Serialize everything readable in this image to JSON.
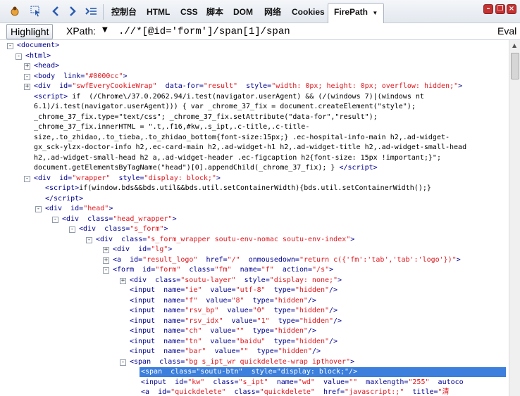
{
  "toolbar": {
    "tabs": [
      "控制台",
      "HTML",
      "CSS",
      "脚本",
      "DOM",
      "网络",
      "Cookies"
    ],
    "active_tab": "FirePath",
    "dropdown_glyph": "▼",
    "icons": [
      "firebug-bug-icon",
      "inspect-element-icon",
      "back-arrow-icon",
      "forward-arrow-icon",
      "command-line-icon"
    ],
    "window_buttons": [
      "minimize-icon",
      "restore-icon",
      "close-icon"
    ]
  },
  "xpath": {
    "highlight_label": "Highlight",
    "label": "XPath:",
    "drop_glyph": "▼",
    "value": ".//*[@id='form']/span[1]/span",
    "eval_label": "Eval"
  },
  "tree": [
    {
      "d": 0,
      "tg": "-",
      "h": "<span class=\"t\">&lt;document&gt;</span>"
    },
    {
      "d": 1,
      "tg": "-",
      "h": "<span class=\"t\">&lt;html&gt;</span>"
    },
    {
      "d": 2,
      "tg": "+",
      "h": "<span class=\"t\">&lt;head&gt;</span>"
    },
    {
      "d": 2,
      "tg": "-",
      "h": "<span class=\"t\">&lt;body</span>  <span class=\"a\">link=</span><span class=\"v\">\"#0000cc\"</span><span class=\"t\">&gt;</span>"
    },
    {
      "d": 3,
      "tg": "+",
      "h": "<span class=\"t\">&lt;div</span>  <span class=\"a\">id=</span><span class=\"v\">\"swfEveryCookieWrap\"</span>  <span class=\"a\">data-for=</span><span class=\"v\">\"result\"</span>  <span class=\"a\">style=</span><span class=\"v\">\"width: 0px; height: 0px; overflow: hidden;\"</span><span class=\"t\">&gt;</span>"
    },
    {
      "d": 3,
      "tg": "",
      "h": "<span class=\"t\">&lt;script&gt;</span><span class=\"tx\"> if  (/Chrome\\/37.0.2062.94/i.test(navigator.userAgent) &amp;&amp; (/(windows 7)|(windows nt</span>"
    },
    {
      "d": 3,
      "tg": "",
      "h": "<span class=\"tx\">6.1)/i.test(navigator.userAgent))) { var _chrome_37_fix = document.createElement(\"style\");</span>"
    },
    {
      "d": 3,
      "tg": "",
      "h": "<span class=\"tx\">_chrome_37_fix.type=\"text/css\"; _chrome_37_fix.setAttribute(\"data-for\",\"result\");</span>"
    },
    {
      "d": 3,
      "tg": "",
      "h": "<span class=\"tx\">_chrome_37_fix.innerHTML = \".t,.f16,#kw,.s_ipt,.c-title,.c-title-</span>"
    },
    {
      "d": 3,
      "tg": "",
      "h": "<span class=\"tx\">size,.to_zhidao,.to_tieba,.to_zhidao_bottom{font-size:15px;} .ec-hospital-info-main h2,.ad-widget-</span>"
    },
    {
      "d": 3,
      "tg": "",
      "h": "<span class=\"tx\">gx_sck-ylzx-doctor-info h2,.ec-card-main h2,.ad-widget-h1 h2,.ad-widget-title h2,.ad-widget-small-head</span>"
    },
    {
      "d": 3,
      "tg": "",
      "h": "<span class=\"tx\">h2,.ad-widget-small-head h2 a,.ad-widget-header .ec-figcaption h2{font-size: 15px !important;}\";</span>"
    },
    {
      "d": 3,
      "tg": "",
      "h": "<span class=\"tx\">document.getElementsByTagName(\"head\")[0].appendChild(_chrome_37_fix); } </span><span class=\"t\">&lt;/script&gt;</span>"
    },
    {
      "d": 3,
      "tg": "-",
      "h": "<span class=\"t\">&lt;div</span>  <span class=\"a\">id=</span><span class=\"v\">\"wrapper\"</span>  <span class=\"a\">style=</span><span class=\"v\">\"display: block;\"</span><span class=\"t\">&gt;</span>"
    },
    {
      "d": 4,
      "tg": "",
      "h": "<span class=\"t\">&lt;script&gt;</span><span class=\"tx\">if(window.bds&amp;&amp;bds.util&amp;&amp;bds.util.setContainerWidth){bds.util.setContainerWidth();}</span>"
    },
    {
      "d": 4,
      "tg": "",
      "h": "<span class=\"t\">&lt;/script&gt;</span>"
    },
    {
      "d": 4,
      "tg": "-",
      "h": "<span class=\"t\">&lt;div</span>  <span class=\"a\">id=</span><span class=\"v\">\"head\"</span><span class=\"t\">&gt;</span>"
    },
    {
      "d": 5,
      "tg": "-",
      "h": "<span class=\"t\">&lt;div</span>  <span class=\"a\">class=</span><span class=\"v\">\"head_wrapper\"</span><span class=\"t\">&gt;</span>"
    },
    {
      "d": 6,
      "tg": "-",
      "h": "<span class=\"t\">&lt;div</span>  <span class=\"a\">class=</span><span class=\"v\">\"s_form\"</span><span class=\"t\">&gt;</span>"
    },
    {
      "d": 7,
      "tg": "-",
      "h": "<span class=\"t\">&lt;div</span>  <span class=\"a\">class=</span><span class=\"v\">\"s_form_wrapper soutu-env-nomac soutu-env-index\"</span><span class=\"t\">&gt;</span>"
    },
    {
      "d": 8,
      "tg": "+",
      "h": "<span class=\"t\">&lt;div</span>  <span class=\"a\">id=</span><span class=\"v\">\"lg\"</span><span class=\"t\">&gt;</span>"
    },
    {
      "d": 8,
      "tg": "+",
      "h": "<span class=\"t\">&lt;a</span>  <span class=\"a\">id=</span><span class=\"v\">\"result_logo\"</span>  <span class=\"a\">href=</span><span class=\"v\">\"/\"</span>  <span class=\"a\">onmousedown=</span><span class=\"v\">\"return c({'fm':'tab','tab':'logo'})\"</span><span class=\"t\">&gt;</span>"
    },
    {
      "d": 8,
      "tg": "-",
      "h": "<span class=\"t\">&lt;form</span>  <span class=\"a\">id=</span><span class=\"v\">\"form\"</span>  <span class=\"a\">class=</span><span class=\"v\">\"fm\"</span>  <span class=\"a\">name=</span><span class=\"v\">\"f\"</span>  <span class=\"a\">action=</span><span class=\"v\">\"/s\"</span><span class=\"t\">&gt;</span>"
    },
    {
      "d": 9,
      "tg": "+",
      "h": "<span class=\"t\">&lt;div</span>  <span class=\"a\">class=</span><span class=\"v\">\"soutu-layer\"</span>  <span class=\"a\">style=</span><span class=\"v\">\"display: none;\"</span><span class=\"t\">&gt;</span>"
    },
    {
      "d": 9,
      "tg": "",
      "h": "<span class=\"t\">&lt;input</span>  <span class=\"a\">name=</span><span class=\"v\">\"ie\"</span>  <span class=\"a\">value=</span><span class=\"v\">\"utf-8\"</span>  <span class=\"a\">type=</span><span class=\"v\">\"hidden\"</span><span class=\"t\">/&gt;</span>"
    },
    {
      "d": 9,
      "tg": "",
      "h": "<span class=\"t\">&lt;input</span>  <span class=\"a\">name=</span><span class=\"v\">\"f\"</span>  <span class=\"a\">value=</span><span class=\"v\">\"8\"</span>  <span class=\"a\">type=</span><span class=\"v\">\"hidden\"</span><span class=\"t\">/&gt;</span>"
    },
    {
      "d": 9,
      "tg": "",
      "h": "<span class=\"t\">&lt;input</span>  <span class=\"a\">name=</span><span class=\"v\">\"rsv_bp\"</span>  <span class=\"a\">value=</span><span class=\"v\">\"0\"</span>  <span class=\"a\">type=</span><span class=\"v\">\"hidden\"</span><span class=\"t\">/&gt;</span>"
    },
    {
      "d": 9,
      "tg": "",
      "h": "<span class=\"t\">&lt;input</span>  <span class=\"a\">name=</span><span class=\"v\">\"rsv_idx\"</span>  <span class=\"a\">value=</span><span class=\"v\">\"1\"</span>  <span class=\"a\">type=</span><span class=\"v\">\"hidden\"</span><span class=\"t\">/&gt;</span>"
    },
    {
      "d": 9,
      "tg": "",
      "h": "<span class=\"t\">&lt;input</span>  <span class=\"a\">name=</span><span class=\"v\">\"ch\"</span>  <span class=\"a\">value=</span><span class=\"v\">\"\"</span>  <span class=\"a\">type=</span><span class=\"v\">\"hidden\"</span><span class=\"t\">/&gt;</span>"
    },
    {
      "d": 9,
      "tg": "",
      "h": "<span class=\"t\">&lt;input</span>  <span class=\"a\">name=</span><span class=\"v\">\"tn\"</span>  <span class=\"a\">value=</span><span class=\"v\">\"baidu\"</span>  <span class=\"a\">type=</span><span class=\"v\">\"hidden\"</span><span class=\"t\">/&gt;</span>"
    },
    {
      "d": 9,
      "tg": "",
      "h": "<span class=\"t\">&lt;input</span>  <span class=\"a\">name=</span><span class=\"v\">\"bar\"</span>  <span class=\"a\">value=</span><span class=\"v\">\"\"</span>  <span class=\"a\">type=</span><span class=\"v\">\"hidden\"</span><span class=\"t\">/&gt;</span>"
    },
    {
      "d": 9,
      "tg": "-",
      "h": "<span class=\"t\">&lt;span</span>  <span class=\"a\">class=</span><span class=\"v\">\"bg s_ipt_wr quickdelete-wrap ipthover\"</span><span class=\"t\">&gt;</span>"
    },
    {
      "d": 10,
      "tg": "",
      "sel": true,
      "h": "<span class=\"t\">&lt;span</span>  <span class=\"a\">class=</span><span class=\"v\">\"soutu-btn\"</span>  <span class=\"a\">style=</span><span class=\"v\">\"display: block;\"</span><span class=\"t\">/&gt;</span>"
    },
    {
      "d": 10,
      "tg": "",
      "h": "<span class=\"t\">&lt;input</span>  <span class=\"a\">id=</span><span class=\"v\">\"kw\"</span>  <span class=\"a\">class=</span><span class=\"v\">\"s_ipt\"</span>  <span class=\"a\">name=</span><span class=\"v\">\"wd\"</span>  <span class=\"a\">value=</span><span class=\"v\">\"\"</span>  <span class=\"a\">maxlength=</span><span class=\"v\">\"255\"</span>  <span class=\"a\">autoco</span>"
    },
    {
      "d": 10,
      "tg": "",
      "h": "<span class=\"t\">&lt;a</span>  <span class=\"a\">id=</span><span class=\"v\">\"quickdelete\"</span>  <span class=\"a\">class=</span><span class=\"v\">\"quickdelete\"</span>  <span class=\"a\">href=</span><span class=\"v\">\"javascript:;\"</span>  <span class=\"a\">title=</span><span class=\"v\">\"清</span>"
    }
  ],
  "colors": {
    "tag": "#000090",
    "value": "#e0181e",
    "selection": "#3c7fdc"
  }
}
